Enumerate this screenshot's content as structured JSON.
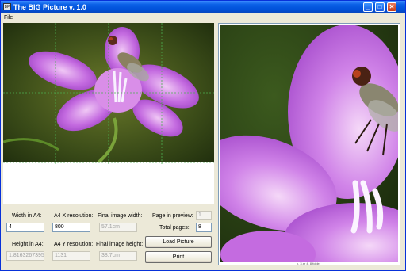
{
  "window": {
    "title": "The BIG Picture v. 1.0",
    "icon": "app-icon",
    "app_icon_text": "BP"
  },
  "titlebar_buttons": {
    "minimize": "_",
    "maximize": "□",
    "close": "✕"
  },
  "menu": {
    "items": [
      "File"
    ]
  },
  "preview": {
    "grid_columns": 4,
    "grid_rows": 4,
    "preview_label": "p. 3 ar 4, 8 folder"
  },
  "form": {
    "width_label": "Width in A4:",
    "width_value": "4",
    "height_label": "Height in A4:",
    "height_value": "1.8163267395",
    "ax_label": "A4 X resolution:",
    "ax_value": "800",
    "ay_label": "A4 Y resolution:",
    "ay_value": "1131",
    "final_width_label": "Final image width:",
    "final_width_value": "57.1cm",
    "final_height_label": "Final image height:",
    "final_height_value": "38.7cm",
    "page_in_preview_label": "Page in preview:",
    "page_in_preview_value": "1",
    "total_pages_label": "Total pages:",
    "total_pages_value": "8",
    "load_button": "Load Picture",
    "print_button": "Print"
  },
  "colors": {
    "titlebar": "#0a5fe6",
    "accent": "#0831d9",
    "flower": "#c46be0",
    "background": "#ece9d8"
  }
}
